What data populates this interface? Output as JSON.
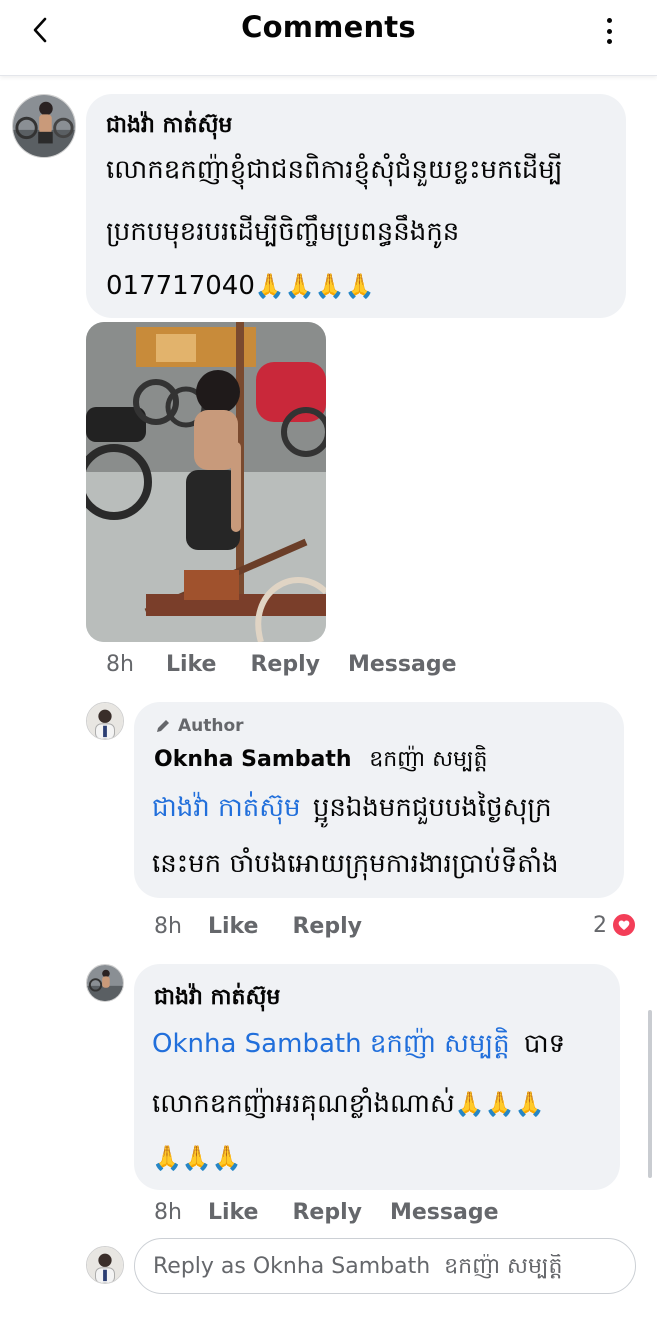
{
  "header": {
    "title": "Comments"
  },
  "comments": [
    {
      "author": "ជាងវ៉ា កាត់ស៊ុម",
      "text_lines": [
        "លោកឧកញ៉ាខ្ញុំជាជនពិការខ្ញុំសុំជំនួយខ្លះមកដើម្បី",
        "ប្រកបមុខរបរដើម្បីចិញ្ចឹមប្រពន្ធនឹងកូន"
      ],
      "phone": "017717040",
      "emoji": "🙏🙏🙏🙏",
      "time": "8h",
      "like": "Like",
      "reply": "Reply",
      "message": "Message"
    },
    {
      "badge": "Author",
      "author": "Oknha Sambath",
      "author_km": "ឧកញ៉ា សម្បត្តិ",
      "mention": "ជាងវ៉ា កាត់ស៊ុម",
      "text_line1": "ប្អូនឯងមកជួបបងថ្ងៃសុក្រ",
      "text_line2": "នេះមក ចាំបងអោយក្រុមការងារប្រាប់ទីតាំង",
      "time": "8h",
      "like": "Like",
      "reply": "Reply",
      "reaction_count": "2"
    },
    {
      "author": "ជាងវ៉ា កាត់ស៊ុម",
      "mention": "Oknha Sambath  ឧកញ៉ា សម្បត្តិ",
      "text_after_mention": "បាទ",
      "text_line2": "លោកឧកញ៉ាអរគុណខ្លាំងណាស់",
      "emoji_line2": "🙏🙏🙏",
      "emoji_line3": "🙏🙏🙏",
      "time": "8h",
      "like": "Like",
      "reply": "Reply",
      "message": "Message"
    }
  ],
  "composer": {
    "placeholder": "Reply as Oknha Sambath  ឧកញ៉ា សម្បត្តិ"
  },
  "colors": {
    "link": "#216fdb",
    "bubble": "#f0f2f5",
    "meta": "#65676b",
    "heart": "#f33e58"
  }
}
